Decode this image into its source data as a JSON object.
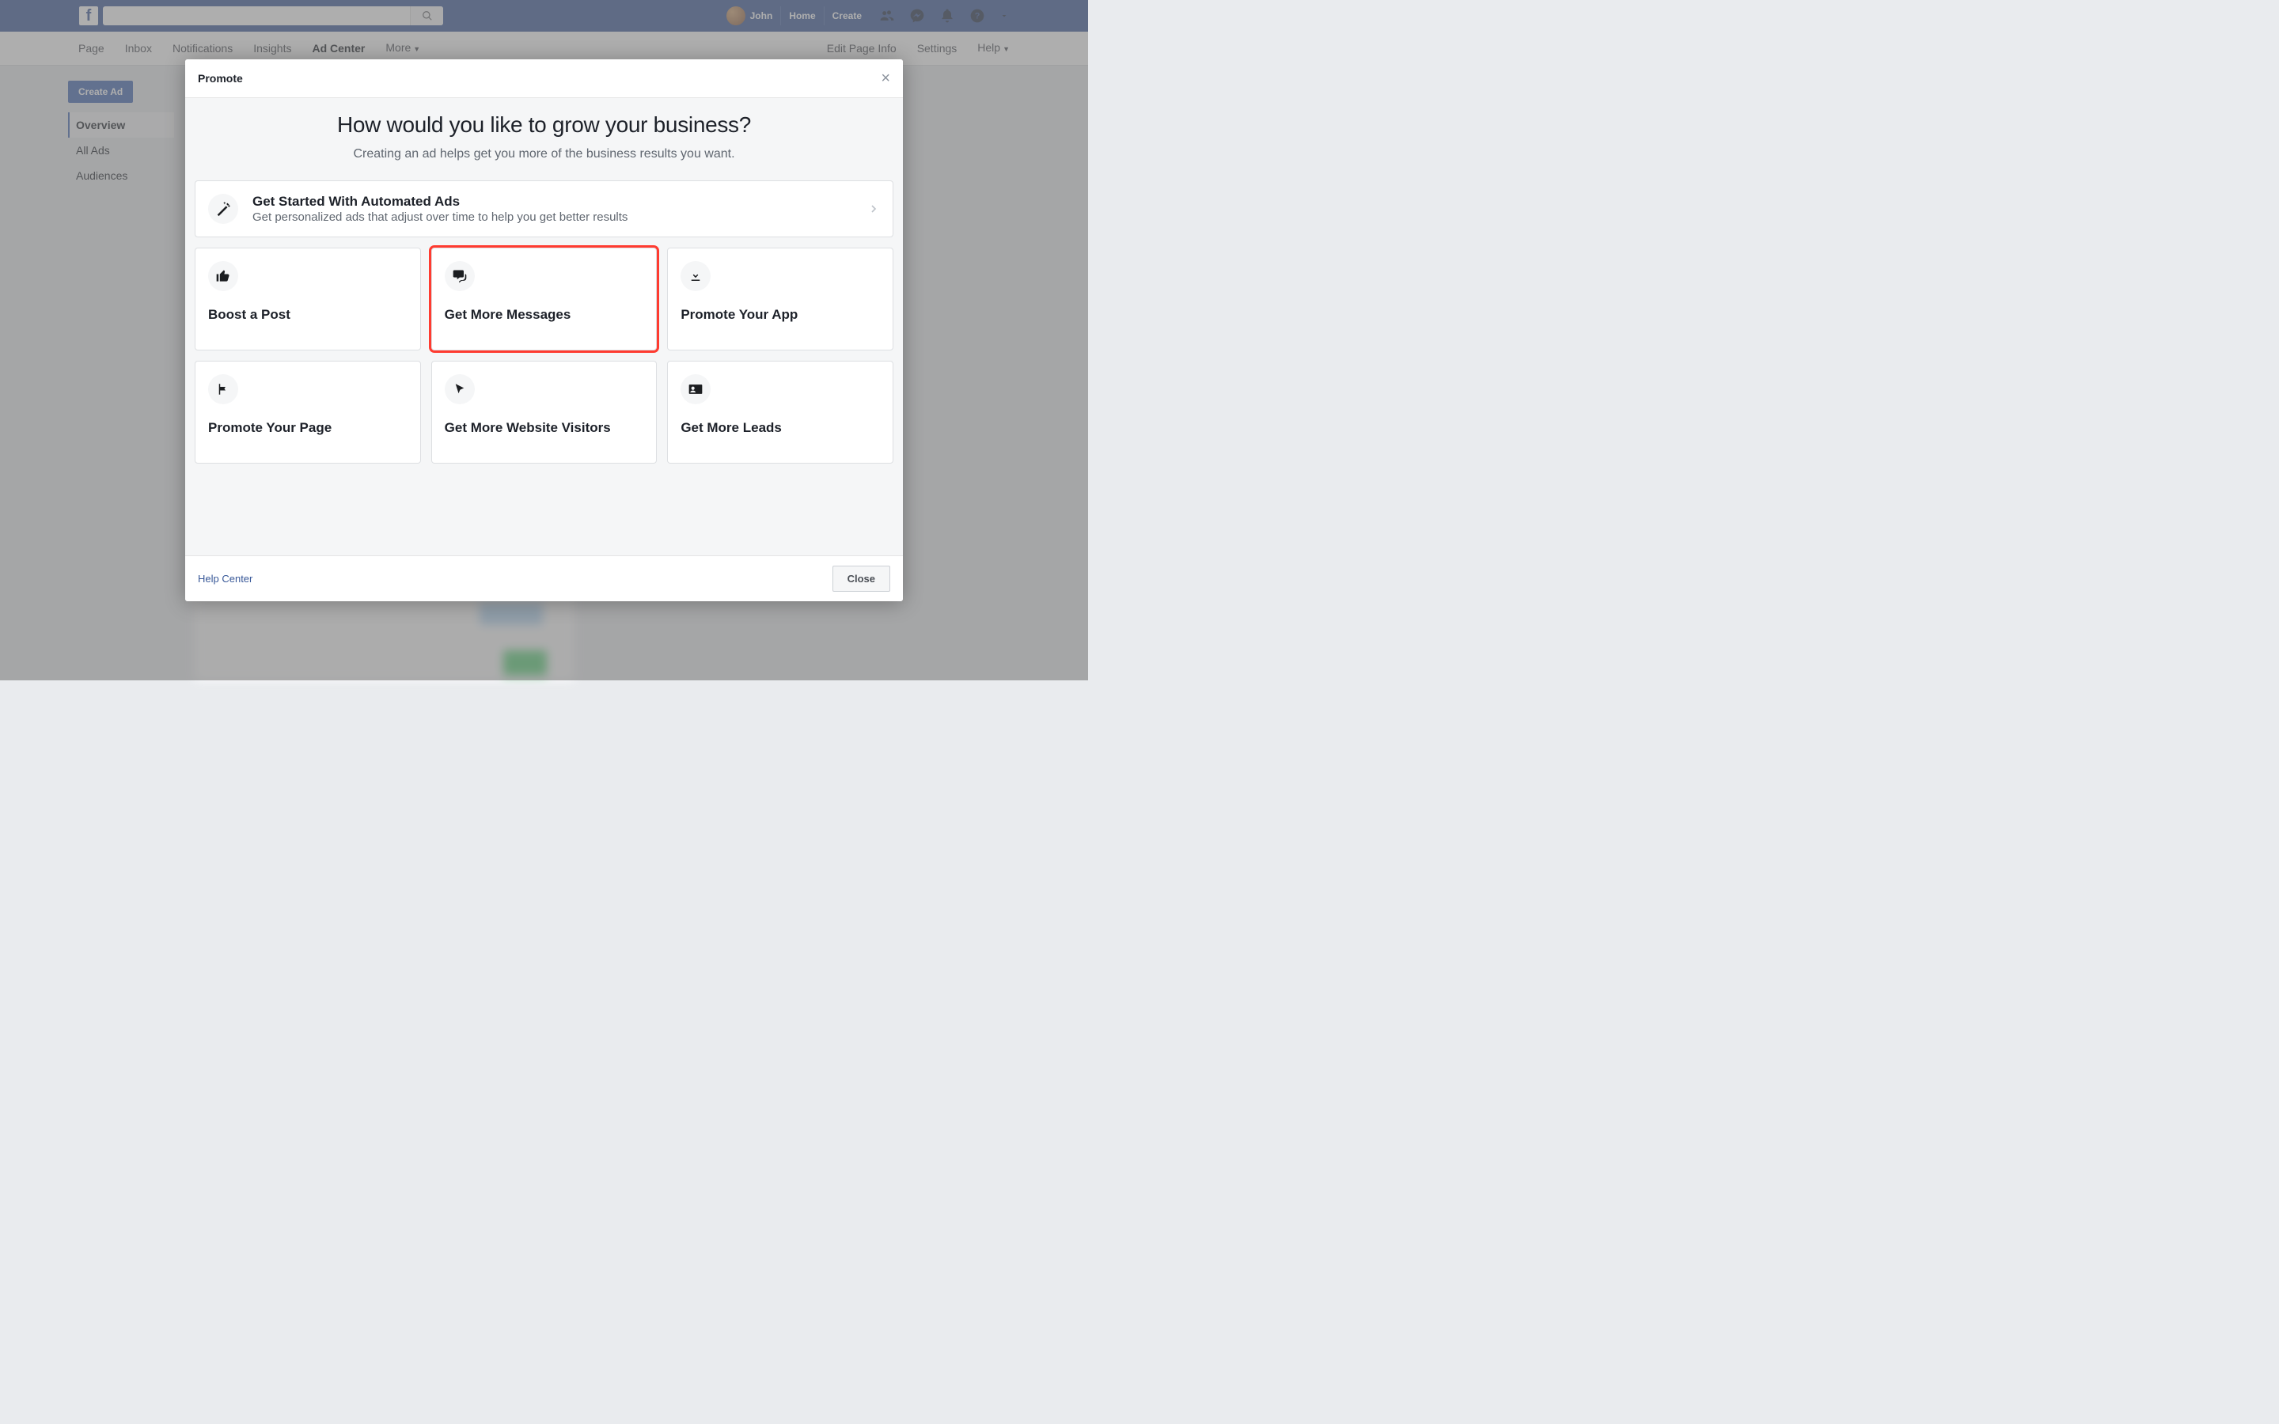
{
  "topbar": {
    "profile_name": "John",
    "home": "Home",
    "create": "Create"
  },
  "pagenav": {
    "page": "Page",
    "inbox": "Inbox",
    "notifications": "Notifications",
    "insights": "Insights",
    "ad_center": "Ad Center",
    "more": "More",
    "edit_page_info": "Edit Page Info",
    "settings": "Settings",
    "help": "Help"
  },
  "sidebar": {
    "create_ad": "Create Ad",
    "overview": "Overview",
    "all_ads": "All Ads",
    "audiences": "Audiences"
  },
  "modal": {
    "title": "Promote",
    "headline": "How would you like to grow your business?",
    "subhead": "Creating an ad helps get you more of the business results you want.",
    "automated": {
      "title": "Get Started With Automated Ads",
      "desc": "Get personalized ads that adjust over time to help you get better results"
    },
    "cards": {
      "boost_post": "Boost a Post",
      "get_messages": "Get More Messages",
      "promote_app": "Promote Your App",
      "promote_page": "Promote Your Page",
      "website_visitors": "Get More Website Visitors",
      "get_leads": "Get More Leads"
    },
    "help_center": "Help Center",
    "close": "Close"
  }
}
